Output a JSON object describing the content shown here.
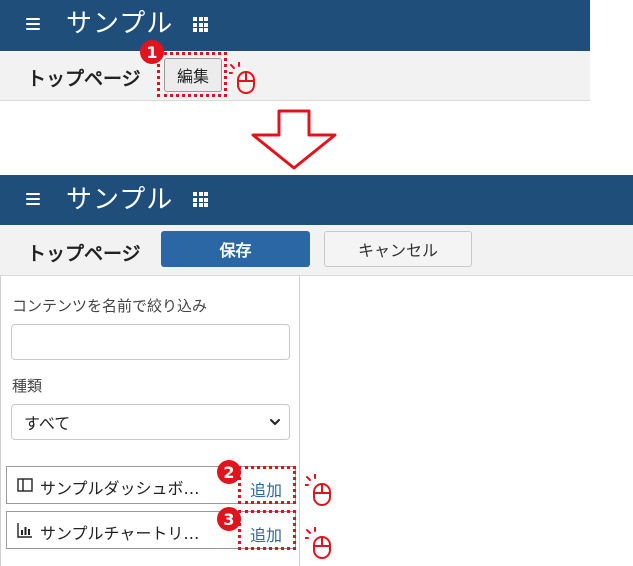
{
  "top_view": {
    "app_title": "サンプル",
    "page_title": "トップページ",
    "edit_button": "編集",
    "step_badge": "1"
  },
  "bottom_view": {
    "app_title": "サンプル",
    "page_title": "トップページ",
    "save_button": "保存",
    "cancel_button": "キャンセル",
    "filter_label": "コンテンツを名前で絞り込み",
    "filter_input_value": "",
    "type_label": "種類",
    "type_select_value": "すべて",
    "items": [
      {
        "label": "サンプルダッシュボ…",
        "add": "追加",
        "badge": "2",
        "icon": "dashboard-icon"
      },
      {
        "label": "サンプルチャートリ…",
        "add": "追加",
        "badge": "3",
        "icon": "chart-icon"
      }
    ]
  },
  "colors": {
    "header": "#1f4e7a",
    "primary": "#2c67a5",
    "highlight": "#e0141c"
  }
}
